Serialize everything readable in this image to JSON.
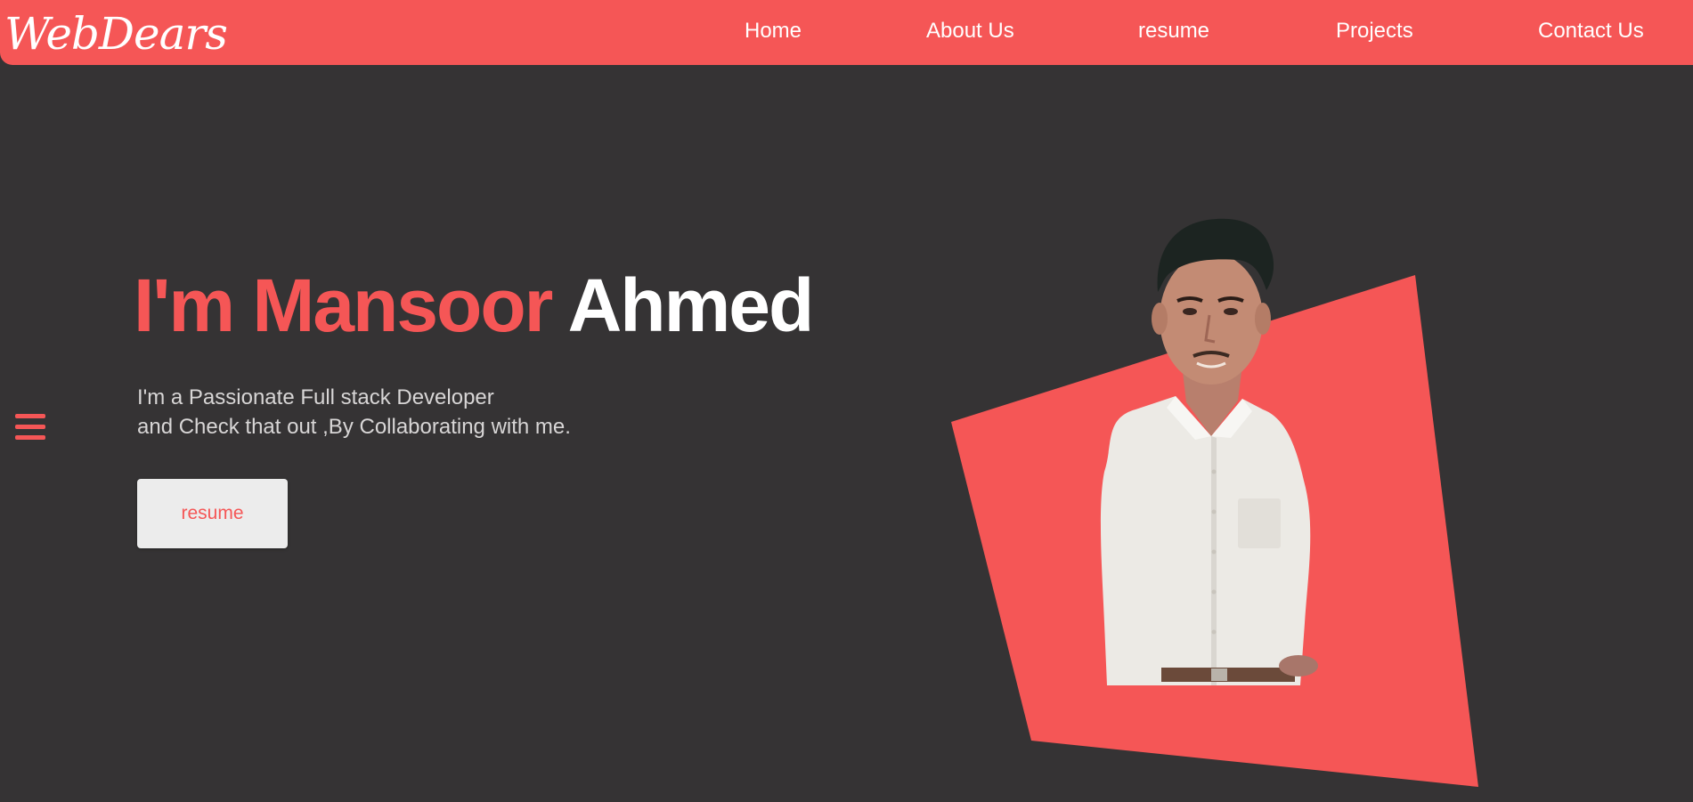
{
  "brand": {
    "logo_text": "WebDears"
  },
  "colors": {
    "accent": "#f55656",
    "background": "#353334",
    "button_bg": "#ececec",
    "text_light": "#ffffff",
    "text_muted": "#d8d6d6"
  },
  "nav": {
    "home": "Home",
    "about": "About Us",
    "resume": "resume",
    "projects": "Projects",
    "contact": "Contact Us"
  },
  "hero": {
    "title_accent": "I'm Mansoor",
    "title_main": "Ahmed",
    "desc_line1": "I'm a Passionate Full stack Developer",
    "desc_line2": "and Check that out ,By Collaborating with me.",
    "button_label": "resume"
  },
  "icons": {
    "menu": "hamburger-menu-icon"
  }
}
